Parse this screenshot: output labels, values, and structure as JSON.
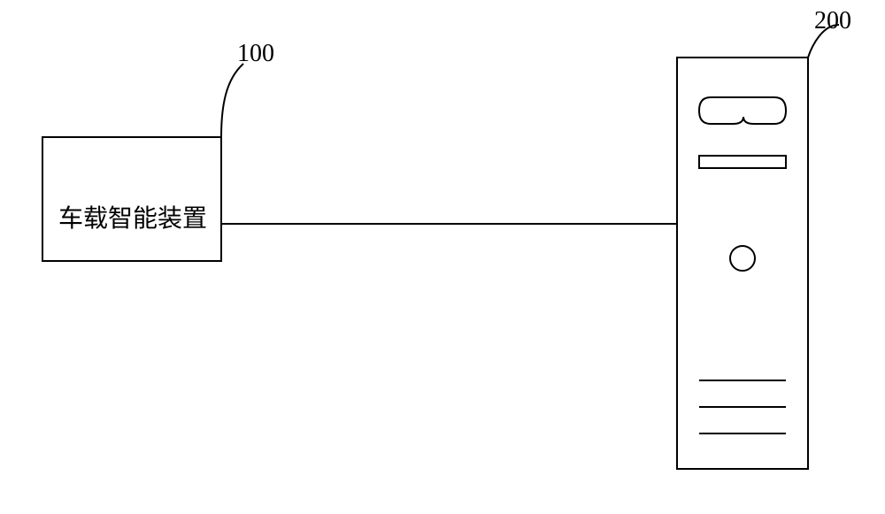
{
  "labels": {
    "left_ref": "100",
    "right_ref": "200"
  },
  "box": {
    "text": "车载智能装置"
  },
  "diagram": {
    "type": "block-diagram",
    "elements": [
      {
        "id": "device",
        "label": "车载智能装置",
        "ref": "100",
        "shape": "rectangle"
      },
      {
        "id": "tower",
        "label": "",
        "ref": "200",
        "shape": "computer-tower"
      }
    ],
    "connections": [
      {
        "from": "device",
        "to": "tower",
        "style": "line"
      }
    ]
  }
}
